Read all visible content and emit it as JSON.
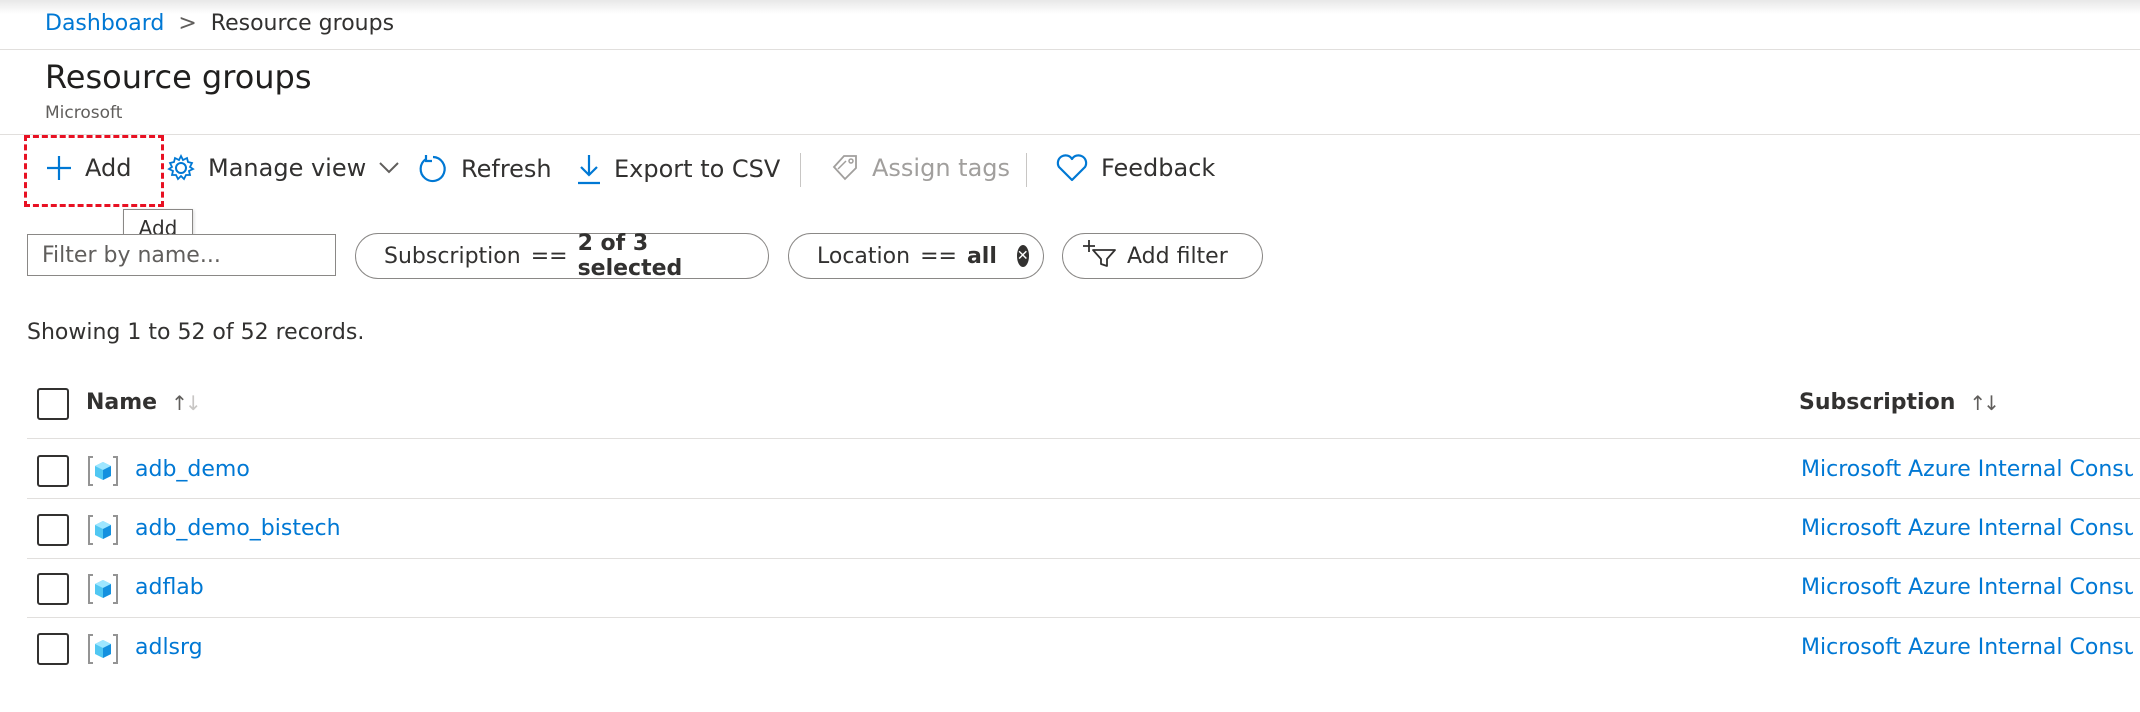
{
  "breadcrumb": {
    "root": "Dashboard",
    "separator": ">",
    "current": "Resource groups"
  },
  "page": {
    "title": "Resource groups",
    "subtitle": "Microsoft"
  },
  "toolbar": {
    "add": "Add",
    "manage_view": "Manage view",
    "refresh": "Refresh",
    "export_csv": "Export to CSV",
    "assign_tags": "Assign tags",
    "feedback": "Feedback",
    "tooltip": "Add"
  },
  "filters": {
    "name_placeholder": "Filter by name...",
    "subscription": {
      "label": "Subscription",
      "operator": "==",
      "value": "2 of 3 selected"
    },
    "location": {
      "label": "Location",
      "operator": "==",
      "value": "all"
    },
    "add_filter": "Add filter"
  },
  "records_text": "Showing 1 to 52 of 52 records.",
  "table": {
    "columns": {
      "name": "Name",
      "subscription": "Subscription"
    },
    "rows": [
      {
        "name": "adb_demo",
        "subscription": "Microsoft Azure Internal Consumption"
      },
      {
        "name": "adb_demo_bistech",
        "subscription": "Microsoft Azure Internal Consumption"
      },
      {
        "name": "adflab",
        "subscription": "Microsoft Azure Internal Consumption"
      },
      {
        "name": "adlsrg",
        "subscription": "Microsoft Azure Internal Consumption"
      }
    ]
  },
  "colors": {
    "link": "#0078d4",
    "highlight": "#e81123",
    "text": "#323130"
  },
  "icons": [
    "plus-icon",
    "gear-icon",
    "chevron-down-icon",
    "refresh-icon",
    "download-icon",
    "tag-icon",
    "heart-icon",
    "clear-icon",
    "add-filter-icon",
    "resource-group-icon"
  ]
}
